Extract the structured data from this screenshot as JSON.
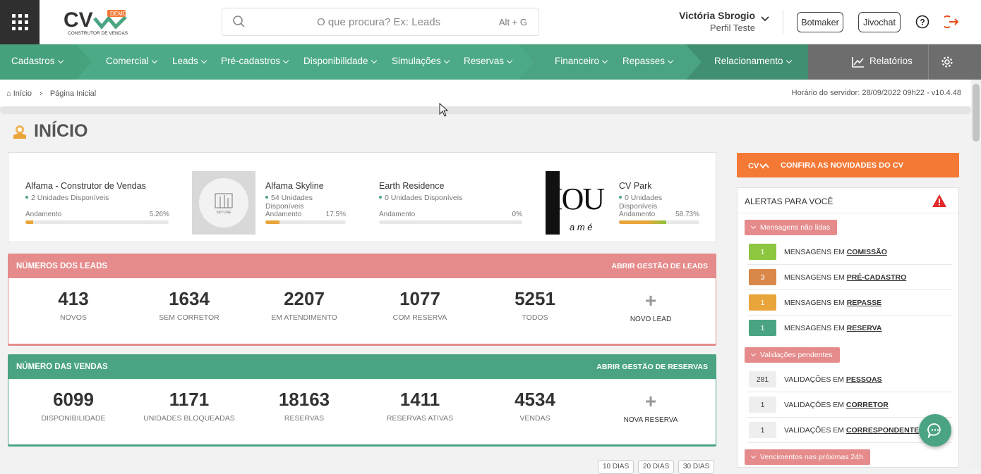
{
  "header": {
    "logo_text": "CV",
    "logo_badge": "DEMO",
    "logo_sub": "CONSTRUTOR DE VENDAS",
    "search_placeholder": "O que procura? Ex: Leads",
    "search_shortcut": "Alt + G",
    "user_name": "Victória Sbrogio",
    "user_profile": "Perfil Teste",
    "btn_botmaker": "Botmaker",
    "btn_jivochat": "Jivochat"
  },
  "nav": {
    "items": [
      "Cadastros",
      "Comercial",
      "Leads",
      "Pré-cadastros",
      "Disponibilidade",
      "Simulações",
      "Reservas",
      "Financeiro",
      "Repasses",
      "Relacionamento"
    ],
    "reports": "Relatórios"
  },
  "breadcrumb": {
    "home": "Início",
    "current": "Página Inicial"
  },
  "server_time": "Horário do servidor: 28/09/2022 09h22 - v10.4.48",
  "page_title": "INÍCIO",
  "enterprises": [
    {
      "name": "Alfama - Construtor de Vendas",
      "units": "2 Unidades Disponíveis",
      "progress_label": "Andamento",
      "progress_text": "5.26%",
      "progress": 5.26
    },
    {
      "name": "Alfama Skyline",
      "units": "54 Unidades Disponíveis",
      "progress_label": "Andamento",
      "progress_text": "17.5%",
      "progress": 17.5,
      "image_text": "SKYLINE"
    },
    {
      "name": "Earth Residence",
      "units": "0 Unidades Disponíveis",
      "progress_label": "Andamento",
      "progress_text": "0%",
      "progress": 0
    },
    {
      "name": "CV Park",
      "units": "0 Unidades Disponíveis",
      "progress_label": "Andamento",
      "progress_text": "58.73%",
      "progress": 58.73,
      "image_text": "IOU",
      "image_sub": "a m é"
    }
  ],
  "leads": {
    "title": "NÚMEROS DOS LEADS",
    "link": "ABRIR GESTÃO DE LEADS",
    "color": "#e58b8b",
    "stats": [
      {
        "value": "413",
        "label": "NOVOS"
      },
      {
        "value": "1634",
        "label": "SEM CORRETOR"
      },
      {
        "value": "2207",
        "label": "EM ATENDIMENTO"
      },
      {
        "value": "1077",
        "label": "COM RESERVA"
      },
      {
        "value": "5251",
        "label": "TODOS"
      }
    ],
    "new_label": "NOVO LEAD"
  },
  "sales": {
    "title": "NÚMERO DAS VENDAS",
    "link": "ABRIR GESTÃO DE RESERVAS",
    "color": "#4aa482",
    "stats": [
      {
        "value": "6099",
        "label": "DISPONIBILIDADE"
      },
      {
        "value": "1171",
        "label": "UNIDADES BLOQUEADAS"
      },
      {
        "value": "18163",
        "label": "RESERVAS"
      },
      {
        "value": "1411",
        "label": "RESERVAS ATIVAS"
      },
      {
        "value": "4534",
        "label": "VENDAS"
      }
    ],
    "new_label": "NOVA RESERVA"
  },
  "bottom": {
    "tabs": [
      "10 DIAS",
      "20 DIAS",
      "30 DIAS"
    ]
  },
  "news_button": "CONFIRA AS NOVIDADES DO CV",
  "alerts": {
    "title": "ALERTAS PARA VOCÊ",
    "groups": [
      {
        "label": "Mensagens não lidas",
        "rows": [
          {
            "count": "1",
            "text": "MENSAGENS EM",
            "link": "COMISSÃO",
            "color": "#8dc63f",
            "fg": "#fff"
          },
          {
            "count": "3",
            "text": "MENSAGENS EM",
            "link": "PRÉ-CADASTRO",
            "color": "#d9884a",
            "fg": "#fff"
          },
          {
            "count": "1",
            "text": "MENSAGENS EM",
            "link": "REPASSE",
            "color": "#e9a53a",
            "fg": "#fff"
          },
          {
            "count": "1",
            "text": "MENSAGENS EM",
            "link": "RESERVA",
            "color": "#4aa482",
            "fg": "#fff"
          }
        ]
      },
      {
        "label": "Validações pendentes",
        "rows": [
          {
            "count": "281",
            "text": "VALIDAÇÕES EM",
            "link": "PESSOAS",
            "color": "#eeeeee",
            "fg": "#333"
          },
          {
            "count": "1",
            "text": "VALIDAÇÕES EM",
            "link": "CORRETOR",
            "color": "#eeeeee",
            "fg": "#333"
          },
          {
            "count": "1",
            "text": "VALIDAÇÕES EM",
            "link": "CORRESPONDENTE",
            "color": "#eeeeee",
            "fg": "#333"
          }
        ]
      },
      {
        "label": "Vencimentos nas próximas 24h",
        "rows": []
      }
    ]
  }
}
